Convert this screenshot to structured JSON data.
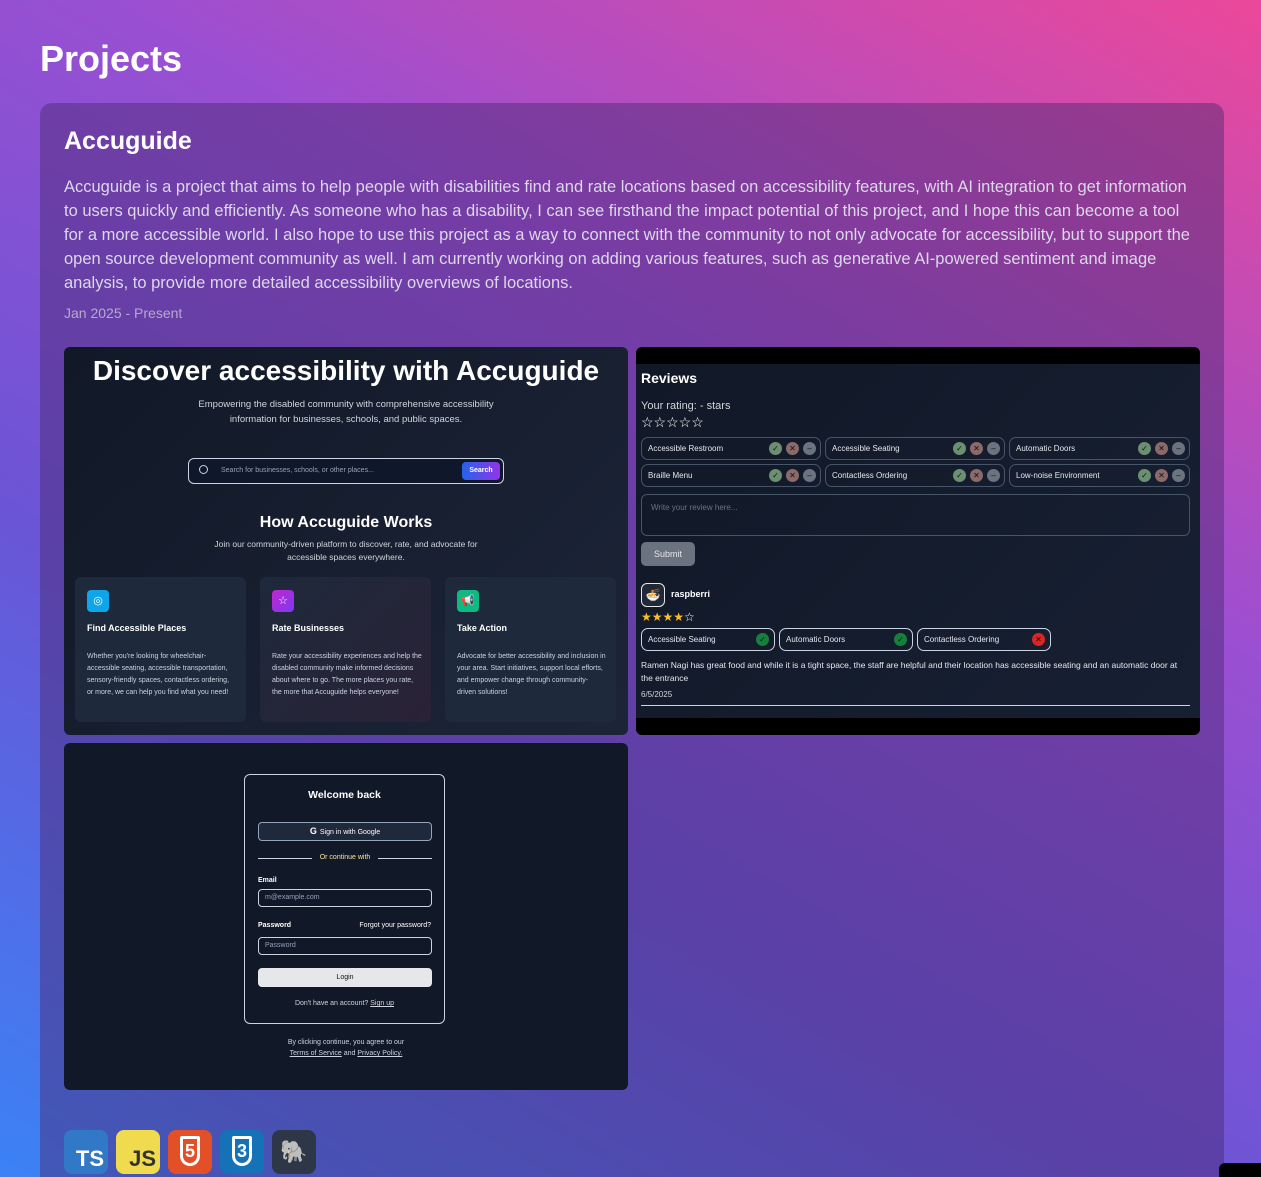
{
  "page": {
    "title": "Projects"
  },
  "project": {
    "title": "Accuguide",
    "description": "Accuguide is a project that aims to help people with disabilities find and rate locations based on accessibility features, with AI integration to get information to users quickly and efficiently. As someone who has a disability, I can see firsthand the impact potential of this project, and I hope this can become a tool for a more accessible world. I also hope to use this project as a way to connect with the community to not only advocate for accessibility, but to support the open source development community as well. I am currently working on adding various features, such as generative AI-powered sentiment and image analysis, to provide more detailed accessibility overviews of locations.",
    "dates": "Jan 2025 - Present"
  },
  "home_shot": {
    "hero": "Discover accessibility with Accuguide",
    "subtitle": "Empowering the disabled community with comprehensive accessibility information for businesses, schools, and public spaces.",
    "search_placeholder": "Search for businesses, schools, or other places...",
    "search_button": "Search",
    "how_title": "How Accuguide Works",
    "how_subtitle": "Join our community-driven platform to discover, rate, and advocate for accessible spaces everywhere.",
    "features": [
      {
        "icon": "compass-icon",
        "color": "#0ea5e9",
        "title": "Find Accessible Places",
        "text": "Whether you're looking for wheelchair-accessible seating, accessible transportation, sensory-friendly spaces, contactless ordering, or more, we can help you find what you need!"
      },
      {
        "icon": "star-icon",
        "color": "#c026d3",
        "title": "Rate Businesses",
        "text": "Rate your accessibility experiences and help the disabled community make informed decisions about where to go. The more places you rate, the more that Accuguide helps everyone!"
      },
      {
        "icon": "megaphone-icon",
        "color": "#10b981",
        "title": "Take Action",
        "text": "Advocate for better accessibility and inclusion in your area. Start initiatives, support local efforts, and empower change through community-driven solutions!"
      }
    ]
  },
  "reviews_shot": {
    "title": "Reviews",
    "your_rating": "Your rating: - stars",
    "features": [
      "Accessible Restroom",
      "Accessible Seating",
      "Automatic Doors",
      "Braille Menu",
      "Contactless Ordering",
      "Low-noise Environment"
    ],
    "textarea_placeholder": "Write your review here...",
    "submit": "Submit",
    "review": {
      "user": "raspberri",
      "rating": 4,
      "tags": [
        {
          "label": "Accessible Seating",
          "status": "yes"
        },
        {
          "label": "Automatic Doors",
          "status": "yes"
        },
        {
          "label": "Contactless Ordering",
          "status": "no"
        }
      ],
      "text": "Ramen Nagi has great food and while it is a tight space, the staff are helpful and their location has accessible seating and an automatic door at the entrance",
      "date": "6/5/2025"
    }
  },
  "login_shot": {
    "title": "Welcome back",
    "google": "Sign in with Google",
    "or": "Or continue with",
    "email_label": "Email",
    "email_placeholder": "m@example.com",
    "password_label": "Password",
    "forgot": "Forgot your password?",
    "password_placeholder": "Password",
    "login": "Login",
    "no_account": "Don't have an account?",
    "sign_up": "Sign up",
    "terms_prefix": "By clicking continue, you agree to our",
    "terms": "Terms of Service",
    "and": "and",
    "privacy": "Privacy Policy."
  },
  "tech_stack": [
    {
      "name": "TS",
      "icon": "typescript-icon",
      "bg": "#3178c6",
      "fg": "#ffffff"
    },
    {
      "name": "JS",
      "icon": "javascript-icon",
      "bg": "#f0db4f",
      "fg": "#323330"
    },
    {
      "name": "5",
      "icon": "html5-icon",
      "bg": "#e34f26",
      "fg": "#ffffff"
    },
    {
      "name": "3",
      "icon": "css3-icon",
      "bg": "#1572b6",
      "fg": "#ffffff"
    },
    {
      "name": "🐘",
      "icon": "postgresql-icon",
      "bg": "#2d3748",
      "fg": "#ffffff"
    }
  ]
}
